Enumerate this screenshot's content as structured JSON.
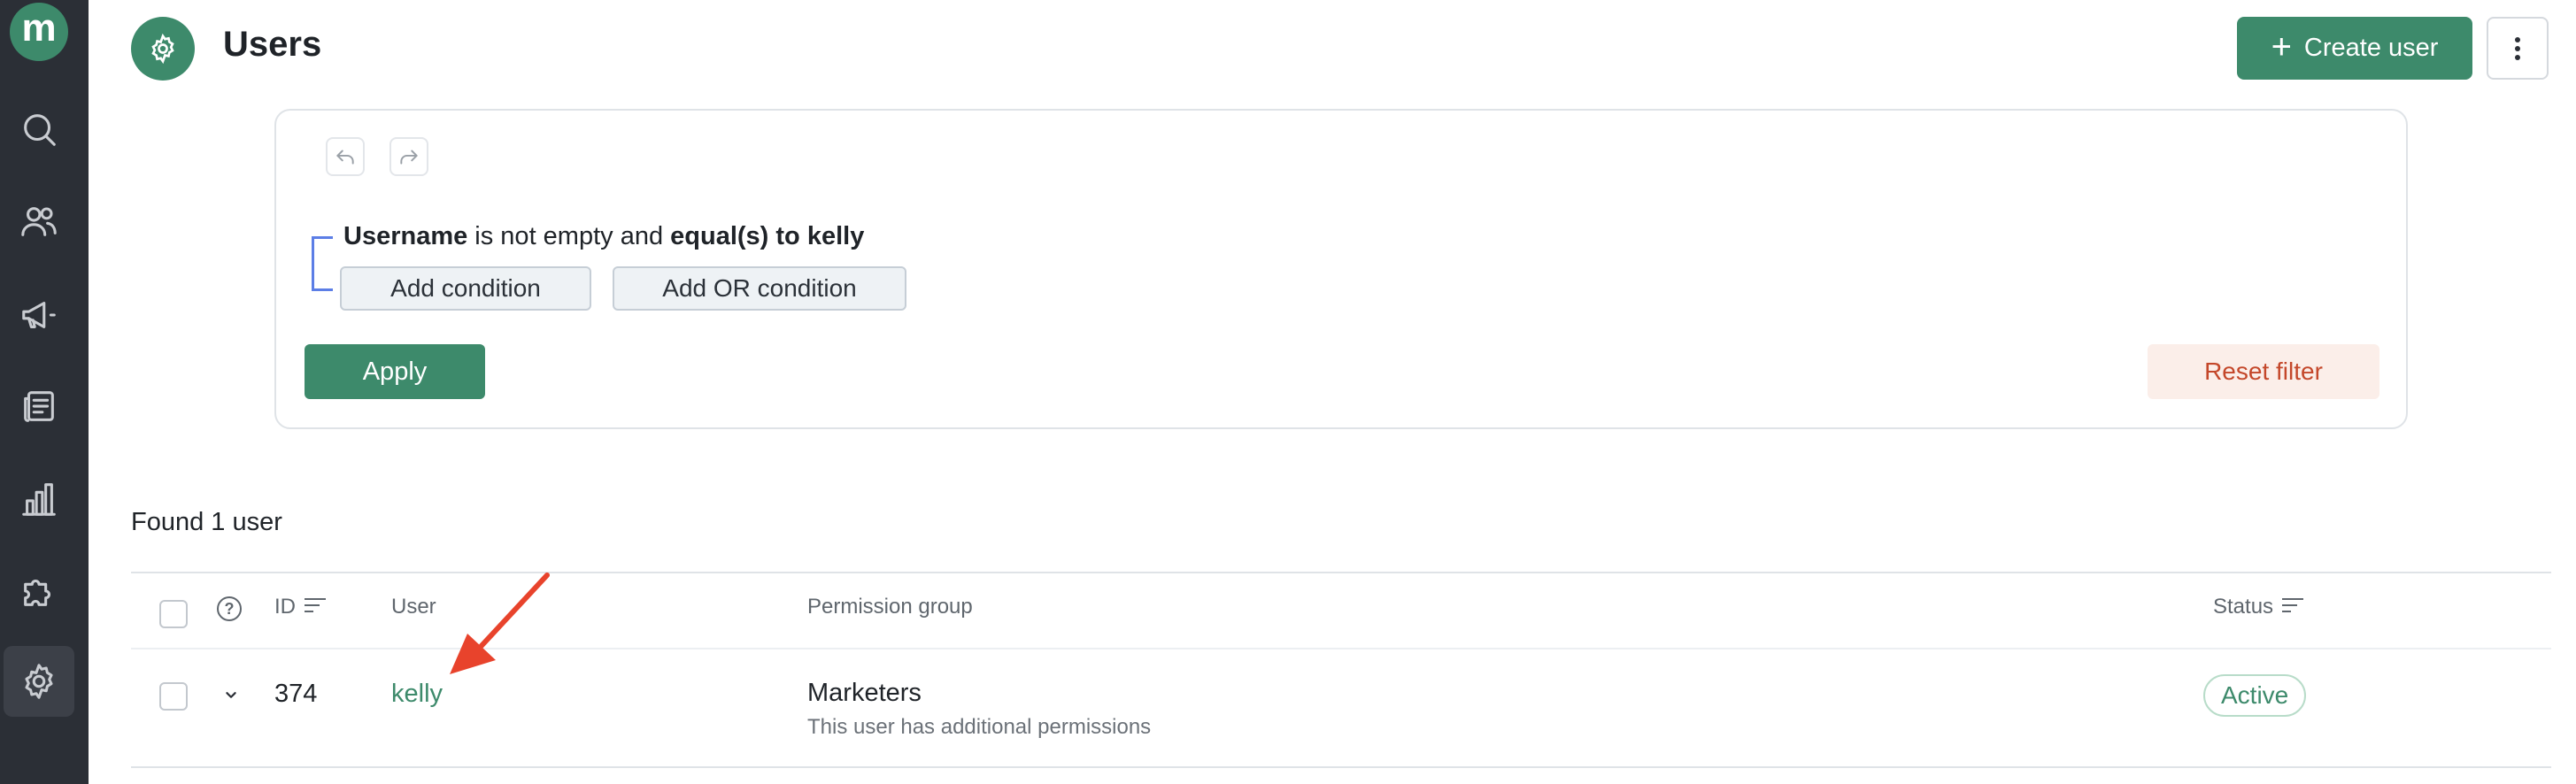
{
  "app": {
    "logo_letter": "m"
  },
  "sidebar": {
    "items": [
      {
        "icon": "search-icon"
      },
      {
        "icon": "users-icon"
      },
      {
        "icon": "megaphone-icon"
      },
      {
        "icon": "news-icon"
      },
      {
        "icon": "bar-chart-icon"
      },
      {
        "icon": "puzzle-icon"
      },
      {
        "icon": "gear-icon",
        "active": true
      }
    ]
  },
  "header": {
    "title": "Users",
    "create_label": "Create user",
    "create_icon": "+"
  },
  "filter": {
    "field": "Username",
    "text1": " is not empty and ",
    "operator": "equal(s) to kelly",
    "add_condition": "Add condition",
    "add_or_condition": "Add OR condition",
    "apply": "Apply",
    "reset": "Reset filter"
  },
  "results": {
    "found_text": "Found 1 user"
  },
  "table": {
    "help_glyph": "?",
    "headers": {
      "id": "ID",
      "user": "User",
      "permission_group": "Permission group",
      "status": "Status"
    },
    "rows": [
      {
        "id": "374",
        "user": "kelly",
        "permission_group": "Marketers",
        "permission_note": "This user has additional permissions",
        "status": "Active"
      }
    ]
  },
  "colors": {
    "brand_green": "#3d8a6b",
    "sidebar_bg": "#2b2f36",
    "reset_text": "#c4472a",
    "annotation_arrow": "#e8432c"
  }
}
